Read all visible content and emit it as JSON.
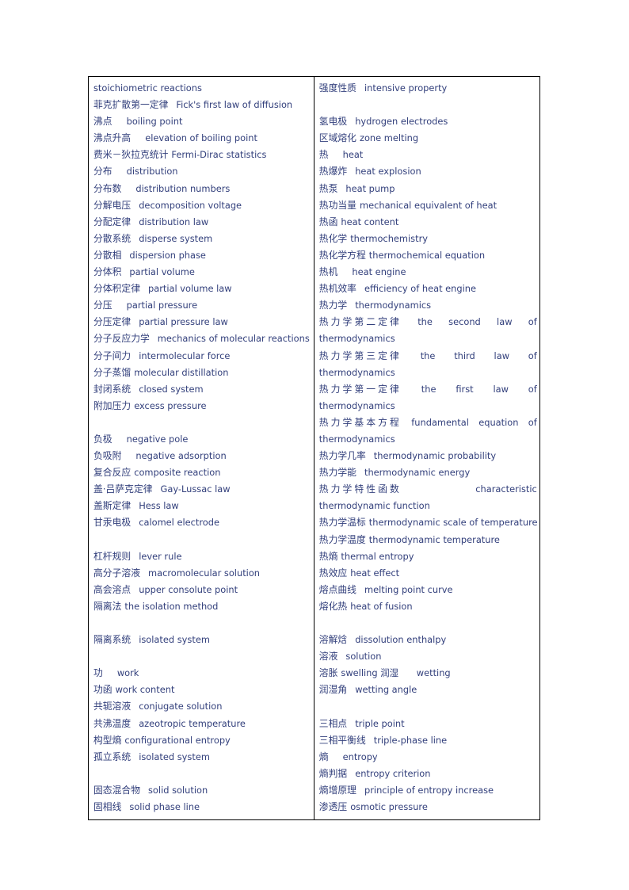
{
  "document": {
    "type": "bilingual-glossary",
    "language_pair": "Chinese-English",
    "text_color": "#33407c",
    "border_color": "#000000"
  },
  "left_column": {
    "name": "left-glossary-column",
    "entries": [
      {
        "cn": "",
        "en": "stoichiometric reactions",
        "gap": "none"
      },
      {
        "cn": "菲克扩散第一定律",
        "en": "Fick's first law of diffusion",
        "gap": "md"
      },
      {
        "cn": "沸点",
        "en": "boiling point",
        "gap": "lg"
      },
      {
        "cn": "沸点升高",
        "en": "elevation of boiling point",
        "gap": "lg"
      },
      {
        "cn": "费米－狄拉克统计",
        "en": "Fermi-Dirac statistics",
        "gap": "sm"
      },
      {
        "cn": "分布",
        "en": "distribution",
        "gap": "lg"
      },
      {
        "cn": "分布数",
        "en": "distribution numbers",
        "gap": "lg"
      },
      {
        "cn": "分解电压",
        "en": "decomposition voltage",
        "gap": "md"
      },
      {
        "cn": "分配定律",
        "en": "distribution law",
        "gap": "md"
      },
      {
        "cn": "分散系统",
        "en": "disperse system",
        "gap": "md"
      },
      {
        "cn": "分散相",
        "en": "dispersion phase",
        "gap": "md"
      },
      {
        "cn": "分体积",
        "en": "partial volume",
        "gap": "md"
      },
      {
        "cn": "分体积定律",
        "en": "partial volume law",
        "gap": "md"
      },
      {
        "cn": "分压",
        "en": "partial pressure",
        "gap": "lg"
      },
      {
        "cn": "分压定律",
        "en": "partial pressure law",
        "gap": "md"
      },
      {
        "cn": "分子反应力学",
        "en": "mechanics of molecular reactions",
        "gap": "md"
      },
      {
        "cn": "分子间力",
        "en": "intermolecular force",
        "gap": "md"
      },
      {
        "cn": "分子蒸馏",
        "en": "molecular distillation",
        "gap": "sm"
      },
      {
        "cn": "封闭系统",
        "en": "closed system",
        "gap": "md"
      },
      {
        "cn": "附加压力",
        "en": "excess pressure",
        "gap": "sm"
      },
      {
        "blank": true
      },
      {
        "cn": "负极",
        "en": "negative pole",
        "gap": "lg"
      },
      {
        "cn": "负吸附",
        "en": "negative adsorption",
        "gap": "lg"
      },
      {
        "cn": "复合反应",
        "en": "composite reaction",
        "gap": "sm"
      },
      {
        "cn": "盖·吕萨克定律",
        "en": "Gay-Lussac law",
        "gap": "md"
      },
      {
        "cn": "盖斯定律",
        "en": "Hess law",
        "gap": "md"
      },
      {
        "cn": "甘汞电极",
        "en": "calomel electrode",
        "gap": "md"
      },
      {
        "blank": true
      },
      {
        "cn": "杠杆规则",
        "en": "lever rule",
        "gap": "md"
      },
      {
        "cn": "高分子溶液",
        "en": "macromolecular solution",
        "gap": "md"
      },
      {
        "cn": "高会溶点",
        "en": "upper consolute point",
        "gap": "md"
      },
      {
        "cn": "隔离法",
        "en": "the isolation method",
        "gap": "sm"
      },
      {
        "blank": true
      },
      {
        "cn": "隔离系统",
        "en": "isolated system",
        "gap": "md"
      },
      {
        "blank": true
      },
      {
        "cn": "功",
        "en": "work",
        "gap": "lg"
      },
      {
        "cn": "功函",
        "en": "work content",
        "gap": "sm"
      },
      {
        "cn": "共轭溶液",
        "en": "conjugate solution",
        "gap": "md"
      },
      {
        "cn": "共沸温度",
        "en": "azeotropic temperature",
        "gap": "md"
      },
      {
        "cn": "构型熵",
        "en": "configurational entropy",
        "gap": "sm"
      },
      {
        "cn": "孤立系统",
        "en": "isolated system",
        "gap": "md"
      },
      {
        "blank": true
      },
      {
        "cn": "固态混合物",
        "en": "solid solution",
        "gap": "md"
      },
      {
        "cn": "固相线",
        "en": "solid phase line",
        "gap": "md"
      }
    ]
  },
  "right_column": {
    "name": "right-glossary-column",
    "entries": [
      {
        "cn": "强度性质",
        "en": "intensive property",
        "gap": "md"
      },
      {
        "blank": true
      },
      {
        "cn": "氢电极",
        "en": "hydrogen electrodes",
        "gap": "md"
      },
      {
        "cn": "区域熔化",
        "en": "zone melting",
        "gap": "sm"
      },
      {
        "cn": "热",
        "en": "heat",
        "gap": "lg"
      },
      {
        "cn": "热爆炸",
        "en": "heat explosion",
        "gap": "md"
      },
      {
        "cn": "热泵",
        "en": "heat pump",
        "gap": "md"
      },
      {
        "cn": "热功当量",
        "en": "mechanical equivalent of heat",
        "gap": "sm"
      },
      {
        "cn": "热函",
        "en": "heat content",
        "gap": "sm"
      },
      {
        "cn": "热化学",
        "en": "thermochemistry",
        "gap": "sm"
      },
      {
        "cn": "热化学方程",
        "en": "thermochemical equation",
        "gap": "sm"
      },
      {
        "cn": "热机",
        "en": "heat engine",
        "gap": "lg"
      },
      {
        "cn": "热机效率",
        "en": "efficiency of heat engine",
        "gap": "md"
      },
      {
        "cn": "热力学",
        "en": "thermodynamics",
        "gap": "md"
      },
      {
        "cn": "热力学第二定律",
        "en": "the second law of thermodynamics",
        "gap": "justify",
        "justified": true
      },
      {
        "cn": "热力学第三定律",
        "en": "the third law of thermodynamics",
        "gap": "justify",
        "justified": true
      },
      {
        "cn": "热力学第一定律",
        "en": "the first law of thermodynamics",
        "gap": "justify",
        "justified": true
      },
      {
        "cn": "热力学基本方程",
        "en": "fundamental equation of thermodynamics",
        "gap": "justify",
        "justified": true
      },
      {
        "cn": "热力学几率",
        "en": "thermodynamic probability",
        "gap": "md"
      },
      {
        "cn": "热力学能",
        "en": "thermodynamic energy",
        "gap": "md"
      },
      {
        "cn": "热力学特性函数",
        "en": "characteristic thermodynamic function",
        "gap": "justify",
        "justified": true
      },
      {
        "cn": "热力学温标",
        "en": "thermodynamic scale of temperature",
        "gap": "sm"
      },
      {
        "cn": "热力学温度",
        "en": "thermodynamic temperature",
        "gap": "sm"
      },
      {
        "cn": "热熵",
        "en": "thermal entropy",
        "gap": "sm"
      },
      {
        "cn": "热效应",
        "en": "heat effect",
        "gap": "sm"
      },
      {
        "cn": "熔点曲线",
        "en": "melting point curve",
        "gap": "md"
      },
      {
        "cn": "熔化热",
        "en": "heat of fusion",
        "gap": "sm"
      },
      {
        "blank": true
      },
      {
        "cn": "溶解焓",
        "en": "dissolution enthalpy",
        "gap": "md"
      },
      {
        "cn": "溶液",
        "en": "solution",
        "gap": "md"
      },
      {
        "cn": "溶胀",
        "en": "swelling 润湿　　wetting",
        "gap": "sm"
      },
      {
        "cn": "润湿角",
        "en": "wetting angle",
        "gap": "md"
      },
      {
        "blank": true
      },
      {
        "cn": "三相点",
        "en": "triple point",
        "gap": "md"
      },
      {
        "cn": "三相平衡线",
        "en": "triple-phase line",
        "gap": "md"
      },
      {
        "cn": "熵",
        "en": "entropy",
        "gap": "lg"
      },
      {
        "cn": "熵判据",
        "en": "entropy criterion",
        "gap": "md"
      },
      {
        "cn": "熵增原理",
        "en": "principle of entropy increase",
        "gap": "md"
      },
      {
        "cn": "渗透压",
        "en": "osmotic pressure",
        "gap": "sm"
      }
    ]
  }
}
